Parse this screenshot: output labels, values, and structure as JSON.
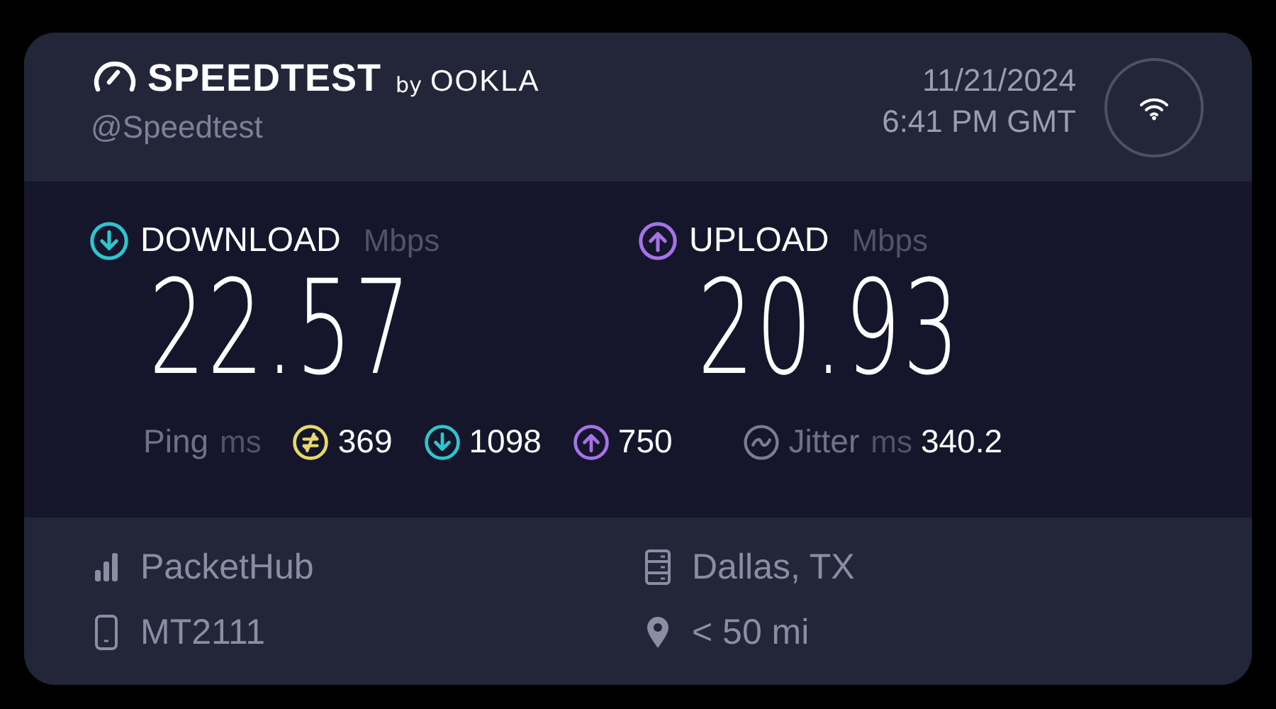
{
  "brand": {
    "name": "SPEEDTEST",
    "by": "by",
    "maker": "OOKLA",
    "handle": "@Speedtest"
  },
  "timestamp": {
    "date": "11/21/2024",
    "time": "6:41 PM GMT"
  },
  "results": [
    {
      "kind": "download",
      "label": "DOWNLOAD",
      "unit": "Mbps",
      "value": "22.57",
      "color": "#2fc4cf"
    },
    {
      "kind": "upload",
      "label": "UPLOAD",
      "unit": "Mbps",
      "value": "20.93",
      "color": "#a673e6"
    }
  ],
  "ping": {
    "label": "Ping",
    "unit": "ms",
    "items": [
      {
        "kind": "idle",
        "value": "369",
        "color": "#e6d86a"
      },
      {
        "kind": "download",
        "value": "1098",
        "color": "#2fc4cf"
      },
      {
        "kind": "upload",
        "value": "750",
        "color": "#a673e6"
      }
    ]
  },
  "jitter": {
    "label": "Jitter",
    "unit": "ms",
    "value": "340.2"
  },
  "details": [
    {
      "kind": "provider",
      "text": "PacketHub"
    },
    {
      "kind": "server",
      "text": "Dallas, TX"
    },
    {
      "kind": "device",
      "text": "MT2111"
    },
    {
      "kind": "distance",
      "text": "< 50 mi"
    }
  ]
}
